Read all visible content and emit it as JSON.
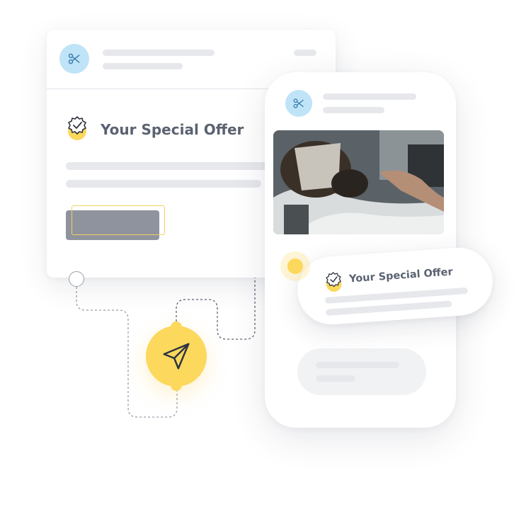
{
  "offer": {
    "title": "Your Special Offer"
  },
  "notification": {
    "title": "Your Special Offer"
  },
  "colors": {
    "accent_yellow": "#fcd85c",
    "avatar_blue": "#bfe3f7",
    "icon_blue": "#3d7fb0",
    "text_gray": "#5b6271",
    "placeholder_gray": "#e6e8ec",
    "button_gray": "#8f939d"
  },
  "icons": {
    "avatar": "scissors-icon",
    "offer_badge": "verified-badge-icon",
    "send": "paper-plane-icon"
  }
}
